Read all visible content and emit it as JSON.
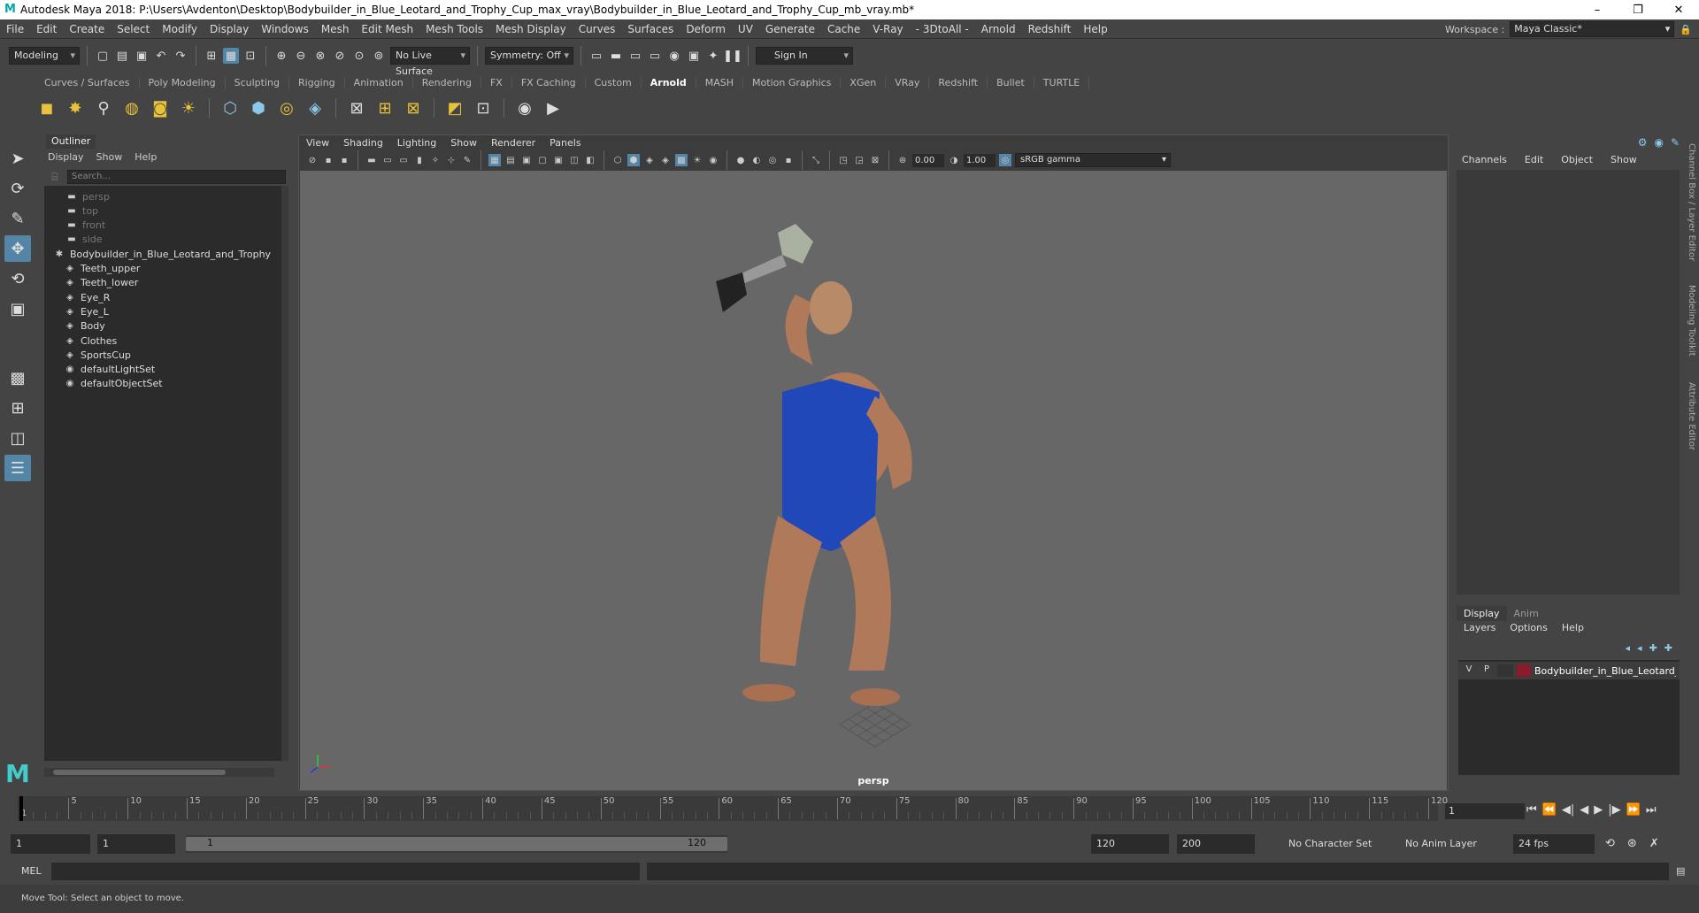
{
  "window": {
    "title": "Autodesk Maya 2018: P:\\Users\\Avdenton\\Desktop\\Bodybuilder_in_Blue_Leotard_and_Trophy_Cup_max_vray\\Bodybuilder_in_Blue_Leotard_and_Trophy_Cup_mb_vray.mb*",
    "controls": [
      "–",
      "❐",
      "✕"
    ]
  },
  "menubar": [
    "File",
    "Edit",
    "Create",
    "Select",
    "Modify",
    "Display",
    "Windows",
    "Mesh",
    "Edit Mesh",
    "Mesh Tools",
    "Mesh Display",
    "Curves",
    "Surfaces",
    "Deform",
    "UV",
    "Generate",
    "Cache",
    "V-Ray",
    "- 3DtoAll -",
    "Arnold",
    "Redshift",
    "Help"
  ],
  "workspace": {
    "label": "Workspace :",
    "value": "Maya Classic*"
  },
  "toolbar": {
    "mode": "Modeling",
    "live_surface": "No Live Surface",
    "symmetry": "Symmetry: Off",
    "sign_in": "Sign In"
  },
  "shelf_tabs": [
    "Curves / Surfaces",
    "Poly Modeling",
    "Sculpting",
    "Rigging",
    "Animation",
    "Rendering",
    "FX",
    "FX Caching",
    "Custom",
    "Arnold",
    "MASH",
    "Motion Graphics",
    "XGen",
    "VRay",
    "Redshift",
    "Bullet",
    "TURTLE"
  ],
  "shelf_active": "Arnold",
  "outliner": {
    "tab": "Outliner",
    "menu": [
      "Display",
      "Show",
      "Help"
    ],
    "search_placeholder": "Search...",
    "items": [
      {
        "label": "persp",
        "dim": true
      },
      {
        "label": "top",
        "dim": true
      },
      {
        "label": "front",
        "dim": true
      },
      {
        "label": "side",
        "dim": true
      },
      {
        "label": "Bodybuilder_in_Blue_Leotard_and_Trophy"
      },
      {
        "label": "Teeth_upper"
      },
      {
        "label": "Teeth_lower"
      },
      {
        "label": "Eye_R"
      },
      {
        "label": "Eye_L"
      },
      {
        "label": "Body"
      },
      {
        "label": "Clothes"
      },
      {
        "label": "SportsCup"
      },
      {
        "label": "defaultLightSet"
      },
      {
        "label": "defaultObjectSet"
      }
    ]
  },
  "viewport": {
    "menu": [
      "View",
      "Shading",
      "Lighting",
      "Show",
      "Renderer",
      "Panels"
    ],
    "exposure": "0.00",
    "gamma_value": "1.00",
    "color_space": "sRGB gamma",
    "camera_label": "persp"
  },
  "channel_box": {
    "menu": [
      "Channels",
      "Edit",
      "Object",
      "Show"
    ]
  },
  "layer_editor": {
    "tabs": [
      "Display",
      "Anim"
    ],
    "menu": [
      "Layers",
      "Options",
      "Help"
    ],
    "layer": {
      "v": "V",
      "p": "P",
      "name": "Bodybuilder_in_Blue_Leotard_a",
      "color": "#8b1a2a"
    }
  },
  "side_tabs": [
    "Channel Box / Layer Editor",
    "Modeling Toolkit",
    "Attribute Editor"
  ],
  "timeline": {
    "ticks": [
      "5",
      "10",
      "15",
      "20",
      "25",
      "30",
      "35",
      "40",
      "45",
      "50",
      "55",
      "60",
      "65",
      "70",
      "75",
      "80",
      "85",
      "90",
      "95",
      "100",
      "105",
      "110",
      "115",
      "120"
    ],
    "start_label": "1",
    "current_frame": "1"
  },
  "range": {
    "start": "1",
    "anim_start": "1",
    "slider_start": "1",
    "slider_end": "120",
    "end": "120",
    "anim_end": "200",
    "character_set": "No Character Set",
    "anim_layer": "No Anim Layer",
    "fps": "24 fps"
  },
  "command": {
    "label": "MEL"
  },
  "help_line": "Move Tool: Select an object to move."
}
